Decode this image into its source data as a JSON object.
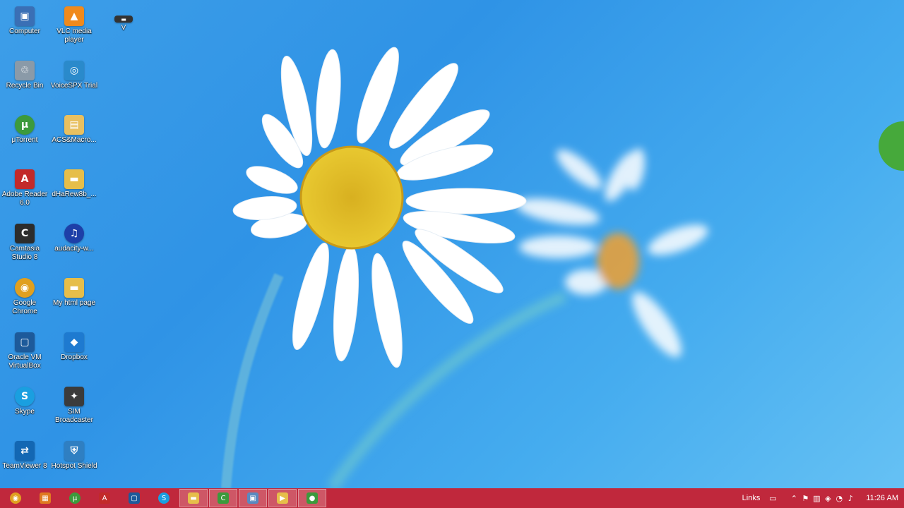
{
  "desktop": {
    "left_column": [
      {
        "label": "Computer",
        "icon": "computer-icon",
        "glyph": "▣",
        "color": "#3a6fb5"
      },
      {
        "label": "Recycle Bin",
        "icon": "recycle-bin-icon",
        "glyph": "♲",
        "color": "#8a9aa8"
      },
      {
        "label": "μTorrent",
        "icon": "utorrent-icon",
        "glyph": "µ",
        "color": "#3c9a3c"
      },
      {
        "label": "Adobe Reader 6.0",
        "icon": "adobe-reader-icon",
        "glyph": "A",
        "color": "#c22a2a"
      },
      {
        "label": "Camtasia Studio 8",
        "icon": "camtasia-icon",
        "glyph": "C",
        "color": "#2c2c2c"
      },
      {
        "label": "Google Chrome",
        "icon": "chrome-icon",
        "glyph": "◉",
        "color": "#e0a020"
      },
      {
        "label": "Oracle VM VirtualBox",
        "icon": "virtualbox-icon",
        "glyph": "▢",
        "color": "#1d5a9a"
      },
      {
        "label": "Skype",
        "icon": "skype-icon",
        "glyph": "S",
        "color": "#1a9fe0"
      },
      {
        "label": "TeamViewer 8",
        "icon": "teamviewer-icon",
        "glyph": "⇄",
        "color": "#1367b3"
      }
    ],
    "right_column": [
      {
        "label": "VLC media player",
        "icon": "vlc-icon",
        "glyph": "▲",
        "color": "#f08a1c"
      },
      {
        "label": "VoiceSPX Trial",
        "icon": "voicespx-icon",
        "glyph": "◎",
        "color": "#2a8acb"
      },
      {
        "label": "ACS&Macro...",
        "icon": "document-icon",
        "glyph": "▤",
        "color": "#e8c060"
      },
      {
        "label": "dHaRew8b_...",
        "icon": "folder-icon",
        "glyph": "▬",
        "color": "#e6be4a"
      },
      {
        "label": "audacity-w...",
        "icon": "audacity-icon",
        "glyph": "♫",
        "color": "#1d3fa8"
      },
      {
        "label": "My html page",
        "icon": "folder-icon",
        "glyph": "▬",
        "color": "#e6be4a"
      },
      {
        "label": "Dropbox",
        "icon": "dropbox-icon",
        "glyph": "◆",
        "color": "#1e7ad0"
      },
      {
        "label": "SIM Broadcaster",
        "icon": "broadcaster-icon",
        "glyph": "✦",
        "color": "#3b3b3b"
      },
      {
        "label": "Hotspot Shield",
        "icon": "hotspot-shield-icon",
        "glyph": "⛨",
        "color": "#2f7fc2"
      }
    ],
    "extra_item": {
      "label": "V",
      "icon": "drive-icon",
      "glyph": "▬",
      "color": "#333333"
    }
  },
  "taskbar": {
    "pinned": [
      {
        "icon": "chrome-icon",
        "glyph": "◉",
        "color": "#e0a020",
        "active": false
      },
      {
        "icon": "file-manager-icon",
        "glyph": "▦",
        "color": "#e07a20",
        "active": false
      },
      {
        "icon": "utorrent-icon",
        "glyph": "µ",
        "color": "#3c9a3c",
        "active": false
      },
      {
        "icon": "adobe-reader-icon",
        "glyph": "A",
        "color": "#c22a2a",
        "active": false
      },
      {
        "icon": "virtualbox-icon",
        "glyph": "▢",
        "color": "#1d5a9a",
        "active": false
      },
      {
        "icon": "skype-icon",
        "glyph": "S",
        "color": "#1a9fe0",
        "active": false
      },
      {
        "icon": "explorer-icon",
        "glyph": "▬",
        "color": "#e6be4a",
        "active": true
      },
      {
        "icon": "camtasia-icon",
        "glyph": "C",
        "color": "#3c9a3c",
        "active": true
      },
      {
        "icon": "window-icon",
        "glyph": "▣",
        "color": "#5a8ac0",
        "active": true
      },
      {
        "icon": "player-icon",
        "glyph": "▶",
        "color": "#e6be4a",
        "active": true
      },
      {
        "icon": "recorder-icon",
        "glyph": "●",
        "color": "#3c9a3c",
        "active": true
      }
    ],
    "tray": {
      "links_label": "Links",
      "time": "11:26 AM",
      "icons": [
        "keyboard-icon",
        "chevron-up-icon",
        "flag-icon",
        "network-icon",
        "shield-icon",
        "wifi-icon",
        "volume-icon"
      ],
      "glyphs": [
        "▭",
        "⌃",
        "⚑",
        "▥",
        "◈",
        "◔",
        "♪"
      ]
    }
  }
}
